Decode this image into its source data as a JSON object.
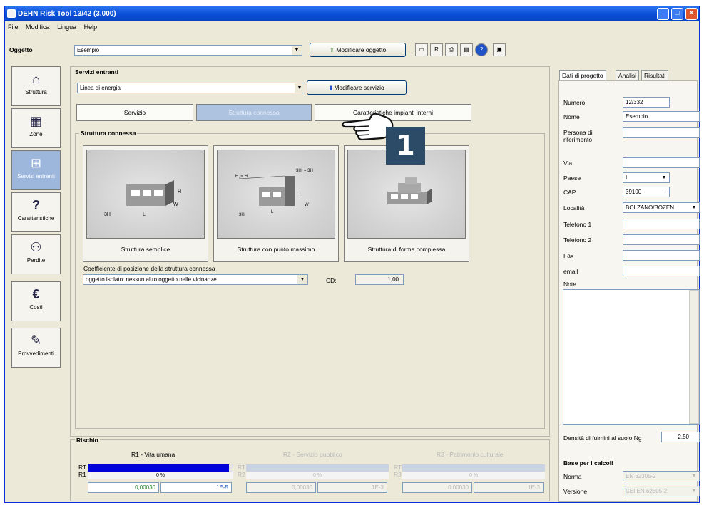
{
  "window": {
    "title": "DEHN Risk Tool 13/42 (3.000)"
  },
  "menu": [
    "File",
    "Modifica",
    "Lingua",
    "Help"
  ],
  "top": {
    "oggetto_label": "Oggetto",
    "oggetto_value": "Esempio",
    "modify_object_btn": "Modificare oggetto"
  },
  "sidebar": [
    {
      "label": "Struttura",
      "icon": "house-icon"
    },
    {
      "label": "Zone",
      "icon": "zone-icon"
    },
    {
      "label": "Servizi entranti",
      "icon": "services-icon"
    },
    {
      "label": "Caratteristiche",
      "icon": "question-icon"
    },
    {
      "label": "Perdite",
      "icon": "people-icon"
    },
    {
      "label": "Costi",
      "icon": "euro-icon"
    },
    {
      "label": "Provvedimenti",
      "icon": "wrench-icon"
    }
  ],
  "services": {
    "group_title": "Servizi entranti",
    "line_value": "Linea di energia",
    "modify_service_btn": "Modificare servizio",
    "tabs": [
      "Servizio",
      "Struttura connessa",
      "Caratteristiche impianti interni"
    ],
    "connected_title": "Struttura connessa",
    "cards": [
      "Struttura semplice",
      "Struttura con punto massimo",
      "Struttura di forma complessa"
    ],
    "coeff_label": "Coefficiente di posizione della struttura connessa",
    "coeff_value": "oggetto isolato: nessun altro oggetto nelle vicinanze",
    "cd_label": "CD:",
    "cd_value": "1,00"
  },
  "risk": {
    "title": "Rischio",
    "r1_title": "R1 - Vita umana",
    "r2_title": "R2 - Servizio pubblico",
    "r3_title": "R3 - Patrimonio culturale",
    "rt_label": "RT",
    "r1_label": "R1",
    "r2_label": "R2",
    "r3_label": "R3",
    "r1_fill": 0.97,
    "r1_percent": "0 %",
    "r2_percent": "0 %",
    "r3_percent": "0 %",
    "r1_value": "0,00030",
    "r1_limit": "1E-5",
    "r2_value": "0,00030",
    "r2_limit": "1E-3",
    "r3_value": "0,00030",
    "r3_limit": "1E-3",
    "accent": "#0000d8"
  },
  "right": {
    "tabs": [
      "Dati di progetto",
      "Analisi",
      "Risultati"
    ],
    "fields": [
      {
        "label": "Numero",
        "value": "12/332"
      },
      {
        "label": "Nome",
        "value": "Esempio"
      },
      {
        "label": "Persona di riferimento",
        "value": ""
      },
      {
        "label": "Via",
        "value": ""
      },
      {
        "label": "Paese",
        "value": "I"
      },
      {
        "label": "CAP",
        "value": "39100"
      },
      {
        "label": "Località",
        "value": "BOLZANO/BOZEN"
      },
      {
        "label": "Telefono 1",
        "value": ""
      },
      {
        "label": "Telefono 2",
        "value": ""
      },
      {
        "label": "Fax",
        "value": ""
      },
      {
        "label": "email",
        "value": ""
      }
    ],
    "note_label": "Note",
    "ng_label": "Densità di fulmini al suolo Ng",
    "ng_value": "2,50",
    "basis_title": "Base per i calcoli",
    "norma_label": "Norma",
    "norma_value": "EN 62305-2",
    "version_label": "Versione",
    "version_value": "CEI EN 62305-2"
  },
  "callout": {
    "number": "1"
  }
}
